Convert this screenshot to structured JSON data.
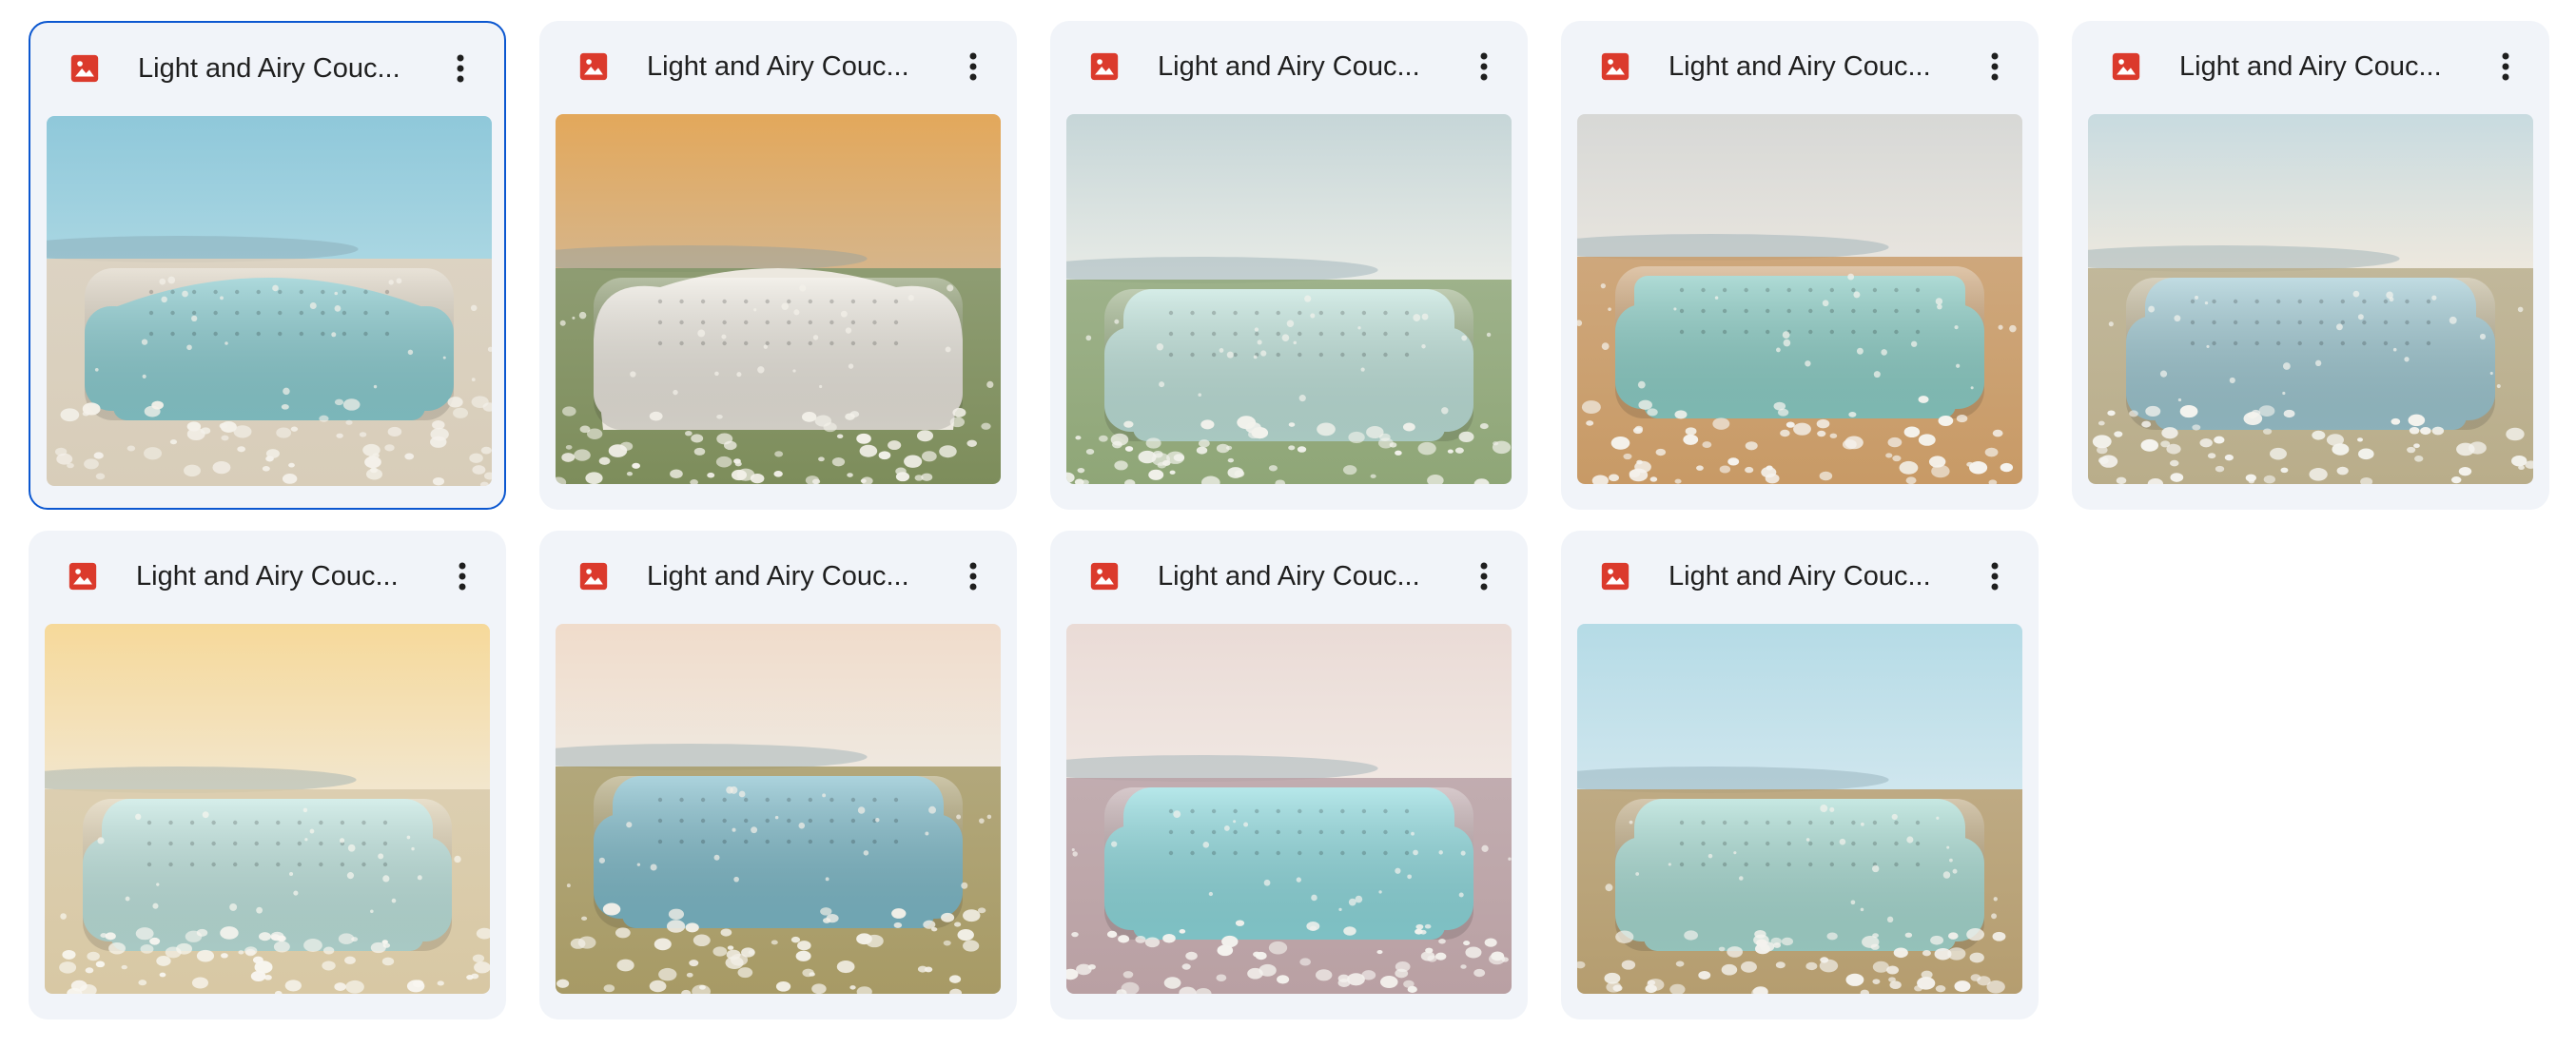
{
  "files": [
    {
      "title": "Light and Airy Couc...",
      "selected": true,
      "icon": "image-file-icon",
      "thumbnail": {
        "sky": "#a9d6e2",
        "sky_top": "#8fc8da",
        "ground": "#d8cdb9",
        "sofa": "#8ccfd3",
        "flowers": "#f4f1ea",
        "style": "camelback"
      }
    },
    {
      "title": "Light and Airy Couc...",
      "selected": false,
      "icon": "image-file-icon",
      "thumbnail": {
        "sky": "#d6b58a",
        "sky_top": "#e3a85b",
        "ground": "#7d8d5b",
        "sofa": "#ece8df",
        "flowers": "#f3f1ea",
        "style": "ornate"
      }
    },
    {
      "title": "Light and Airy Couc...",
      "selected": false,
      "icon": "image-file-icon",
      "thumbnail": {
        "sky": "#e8ebe6",
        "sky_top": "#c6d6d8",
        "ground": "#8fa677",
        "sofa": "#bfe3db",
        "flowers": "#f2f2ec",
        "style": "chesterfield"
      }
    },
    {
      "title": "Light and Airy Couc...",
      "selected": false,
      "icon": "image-file-icon",
      "thumbnail": {
        "sky": "#e7e4de",
        "sky_top": "#d7d8d6",
        "ground": "#c89a66",
        "sofa": "#8ed1c9",
        "flowers": "#f5f3ee",
        "style": "modern"
      }
    },
    {
      "title": "Light and Airy Couc...",
      "selected": false,
      "icon": "image-file-icon",
      "thumbnail": {
        "sky": "#ede8de",
        "sky_top": "#c8dbe0",
        "ground": "#b9ad8a",
        "sofa": "#9fc9d3",
        "flowers": "#f4f3ee",
        "style": "chesterfield"
      }
    },
    {
      "title": "Light and Airy Couc...",
      "selected": false,
      "icon": "image-file-icon",
      "thumbnail": {
        "sky": "#f2e6cd",
        "sky_top": "#f6d99a",
        "ground": "#d8c8a4",
        "sofa": "#bfe5df",
        "flowers": "#f8f6f0",
        "style": "chesterfield"
      }
    },
    {
      "title": "Light and Airy Couc...",
      "selected": false,
      "icon": "image-file-icon",
      "thumbnail": {
        "sky": "#efe8df",
        "sky_top": "#f0dccb",
        "ground": "#a79a65",
        "sofa": "#7fbccb",
        "flowers": "#f3f0e8",
        "style": "chesterfield"
      }
    },
    {
      "title": "Light and Airy Couc...",
      "selected": false,
      "icon": "image-file-icon",
      "thumbnail": {
        "sky": "#f0e7e2",
        "sky_top": "#eadbd6",
        "ground": "#b9a0a3",
        "sofa": "#8fdbdf",
        "flowers": "#f4f2ee",
        "style": "chesterfield"
      }
    },
    {
      "title": "Light and Airy Couc...",
      "selected": false,
      "icon": "image-file-icon",
      "thumbnail": {
        "sky": "#cfe6ee",
        "sky_top": "#b5dbe6",
        "ground": "#b59d6f",
        "sofa": "#a8dcd3",
        "flowers": "#f4f2ed",
        "style": "chesterfield"
      }
    }
  ],
  "colors": {
    "accent": "#0b57d0",
    "card_bg": "#f1f4f9",
    "icon_red": "#db3a2c",
    "text": "#1f1f1f"
  }
}
